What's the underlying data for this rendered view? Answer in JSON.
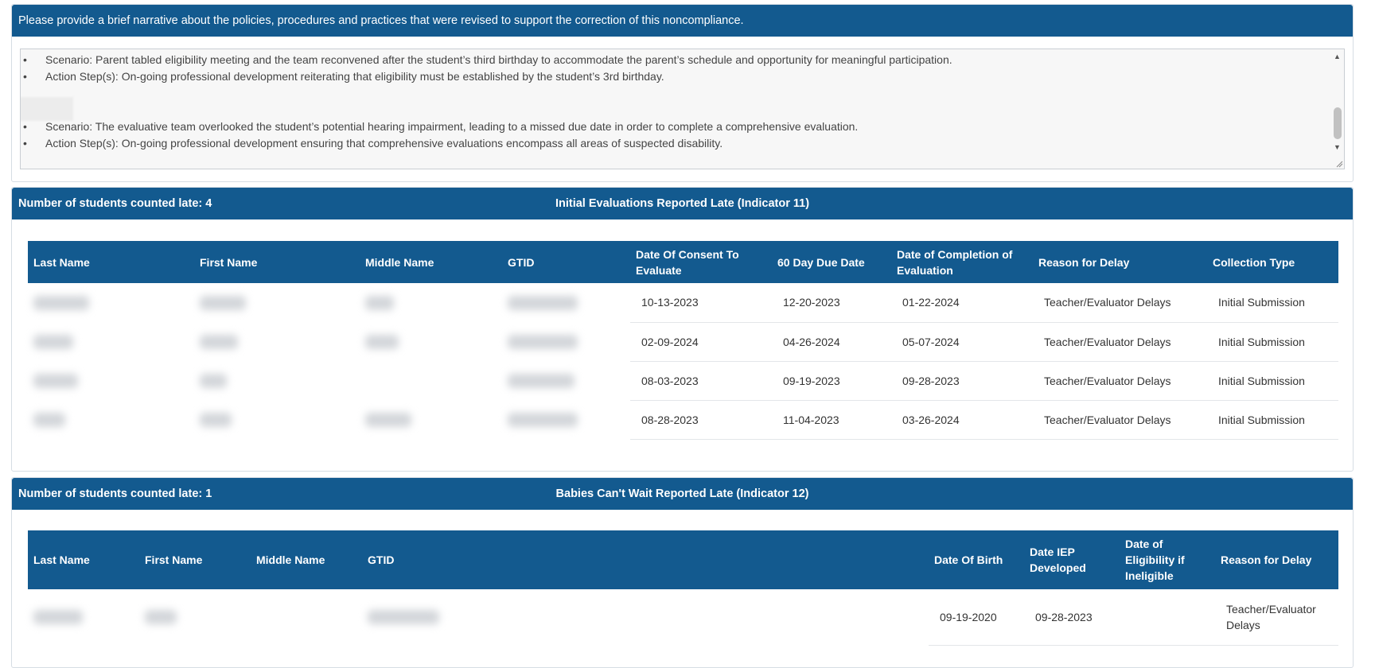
{
  "narrative": {
    "prompt": "Please provide a brief narrative about the policies, procedures and practices that were revised to support the correction of this noncompliance.",
    "lines": [
      "Scenario: Parent tabled eligibility meeting and the team reconvened after the student’s third birthday to accommodate the parent’s schedule and opportunity for meaningful participation.",
      "Action Step(s): On-going professional development reiterating that eligibility must be established by the student’s 3rd birthday.",
      "Scenario: The evaluative team overlooked the student’s potential hearing impairment, leading to a missed due date in order to complete a comprehensive evaluation.",
      "Action Step(s): On-going professional development ensuring that comprehensive evaluations encompass all areas of suspected disability."
    ],
    "bullet": "•"
  },
  "indicator11": {
    "count_label": "Number of students counted late: 4",
    "title": "Initial Evaluations Reported Late (Indicator 11)",
    "columns": [
      "Last Name",
      "First Name",
      "Middle Name",
      "GTID",
      "Date Of Consent To Evaluate",
      "60 Day Due Date",
      "Date of Completion of Evaluation",
      "Reason for Delay",
      "Collection Type"
    ],
    "rows": [
      {
        "consent": "10-13-2023",
        "due": "12-20-2023",
        "completion": "01-22-2024",
        "reason": "Teacher/Evaluator Delays",
        "collection": "Initial Submission"
      },
      {
        "consent": "02-09-2024",
        "due": "04-26-2024",
        "completion": "05-07-2024",
        "reason": "Teacher/Evaluator Delays",
        "collection": "Initial Submission"
      },
      {
        "consent": "08-03-2023",
        "due": "09-19-2023",
        "completion": "09-28-2023",
        "reason": "Teacher/Evaluator Delays",
        "collection": "Initial Submission"
      },
      {
        "consent": "08-28-2023",
        "due": "11-04-2023",
        "completion": "03-26-2024",
        "reason": "Teacher/Evaluator Delays",
        "collection": "Initial Submission"
      }
    ]
  },
  "indicator12": {
    "count_label": "Number of students counted late: 1",
    "title": "Babies Can't Wait Reported Late (Indicator 12)",
    "columns": [
      "Last Name",
      "First Name",
      "Middle Name",
      "GTID",
      "Date Of Birth",
      "Date IEP Developed",
      "Date of Eligibility if Ineligible",
      "Reason for Delay"
    ],
    "rows": [
      {
        "dob": "09-19-2020",
        "iep": "09-28-2023",
        "eligibility": "",
        "reason": "Teacher/Evaluator Delays"
      }
    ]
  }
}
